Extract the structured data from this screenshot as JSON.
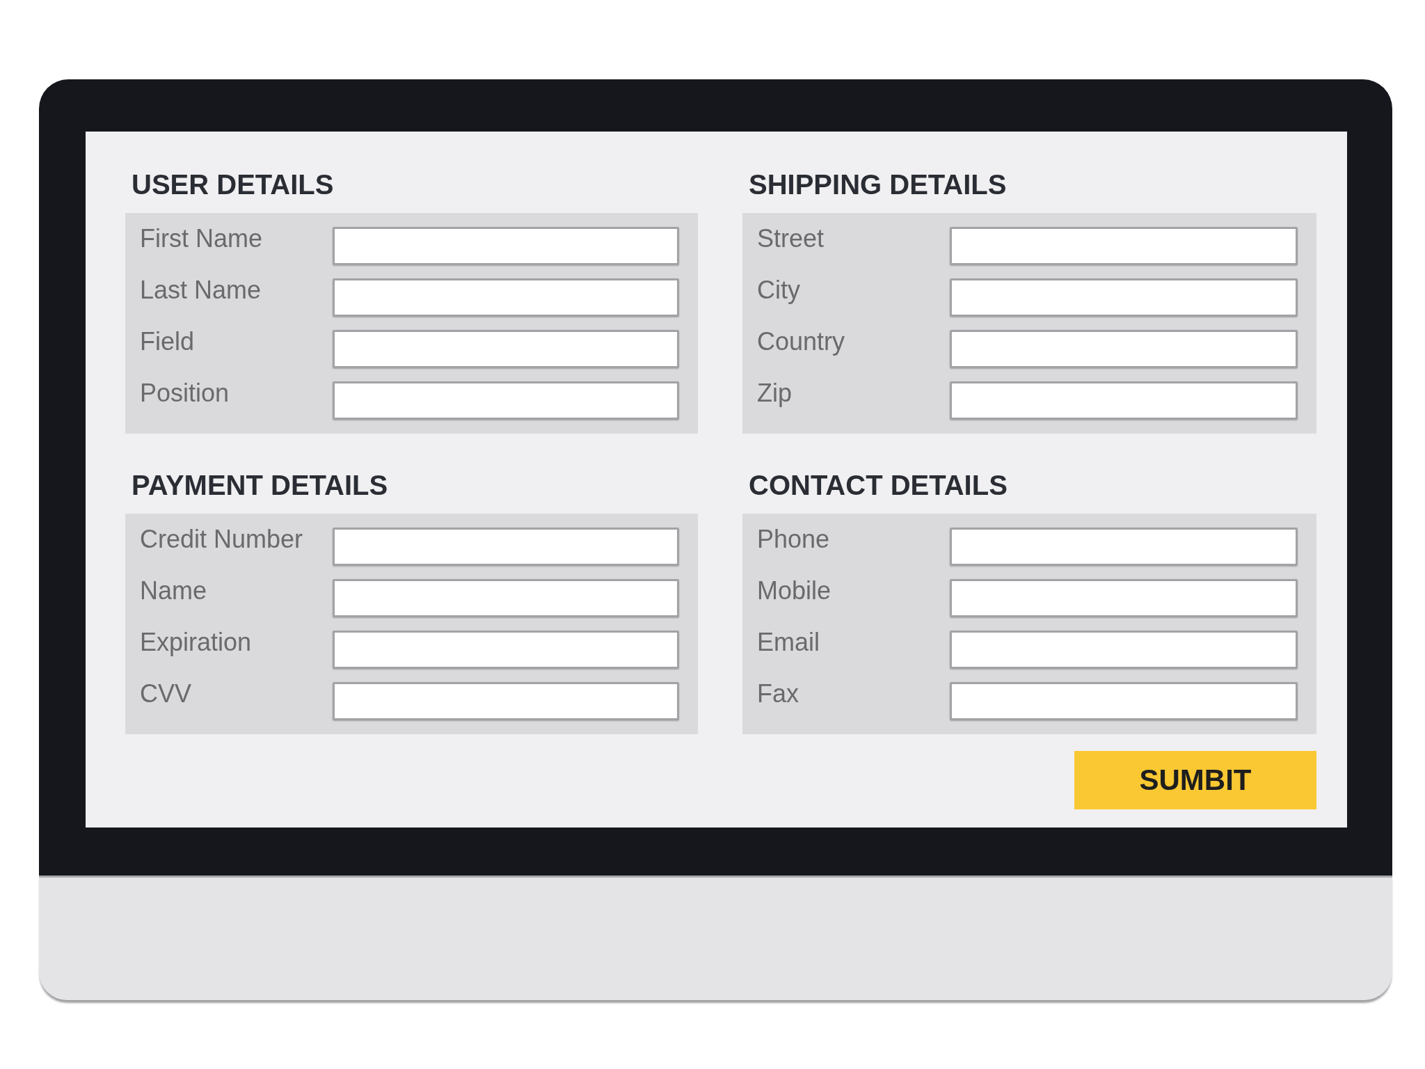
{
  "sections": [
    {
      "title": "USER DETAILS",
      "fields": [
        {
          "label": "First Name"
        },
        {
          "label": "Last Name"
        },
        {
          "label": "Field"
        },
        {
          "label": "Position"
        }
      ]
    },
    {
      "title": "SHIPPING DETAILS",
      "fields": [
        {
          "label": "Street"
        },
        {
          "label": "City"
        },
        {
          "label": "Country"
        },
        {
          "label": "Zip"
        }
      ]
    },
    {
      "title": "PAYMENT DETAILS",
      "fields": [
        {
          "label": "Credit Number"
        },
        {
          "label": "Name"
        },
        {
          "label": "Expiration"
        },
        {
          "label": "CVV"
        }
      ]
    },
    {
      "title": "CONTACT DETAILS",
      "fields": [
        {
          "label": "Phone"
        },
        {
          "label": "Mobile"
        },
        {
          "label": "Email"
        },
        {
          "label": "Fax"
        }
      ]
    }
  ],
  "submit_button": {
    "label": "SUMBIT"
  }
}
